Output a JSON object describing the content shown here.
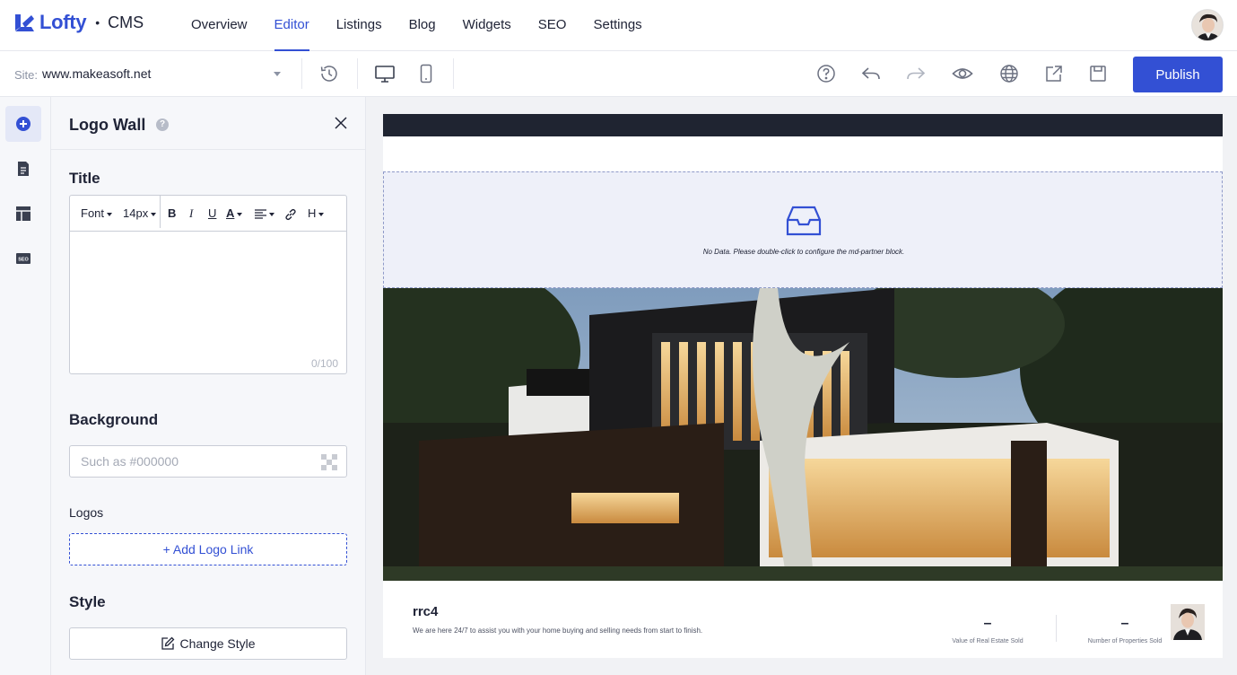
{
  "brand": {
    "name": "Lofty",
    "separator": "•",
    "product": "CMS",
    "color": "#3350d4"
  },
  "nav": [
    {
      "label": "Overview",
      "active": false
    },
    {
      "label": "Editor",
      "active": true
    },
    {
      "label": "Listings",
      "active": false
    },
    {
      "label": "Blog",
      "active": false
    },
    {
      "label": "Widgets",
      "active": false
    },
    {
      "label": "SEO",
      "active": false
    },
    {
      "label": "Settings",
      "active": false
    }
  ],
  "toolbar": {
    "site_label": "Site:",
    "site_value": "www.makeasoft.net",
    "publish_label": "Publish"
  },
  "panel": {
    "title": "Logo Wall",
    "help": "?",
    "title_section": "Title",
    "editor": {
      "font": "Font",
      "size": "14px",
      "bold": "B",
      "italic": "I",
      "underline": "U",
      "color": "A",
      "heading": "H",
      "counter": "0/100"
    },
    "background_section": "Background",
    "background_placeholder": "Such as #000000",
    "logos_label": "Logos",
    "add_logo_label": "+ Add Logo Link",
    "style_section": "Style",
    "change_style_label": "Change Style"
  },
  "preview": {
    "partner_message": "No Data. Please double-click to configure the md-partner block.",
    "agent_name": "rrc4",
    "agent_desc": "We are here 24/7 to assist you with your home buying and selling needs from start to finish.",
    "stats": [
      {
        "value": "–",
        "label": "Value of Real Estate Sold"
      },
      {
        "value": "–",
        "label": "Number of Properties Sold"
      }
    ]
  }
}
